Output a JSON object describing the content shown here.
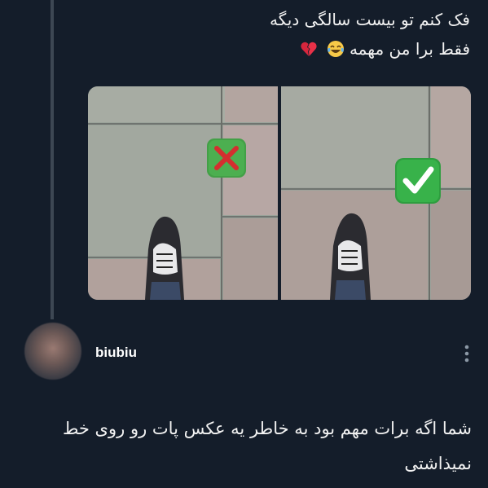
{
  "post": {
    "line1": "فک کنم تو بیست سالگی دیگه",
    "line2": "فقط برا من مهمه",
    "emojis": [
      "laughing-tears-emoji",
      "broken-heart-emoji"
    ]
  },
  "photos": [
    {
      "badge": "cross-mark-icon",
      "badge_color": "#d32f2f"
    },
    {
      "badge": "check-mark-icon",
      "badge_color": "#2ea043"
    }
  ],
  "reply": {
    "username": "biubiu",
    "text": "شما اگه برات مهم بود به خاطر یه عکس پات رو روی خط نمیذاشتی"
  },
  "colors": {
    "background": "#141d2a",
    "thread_line": "#3d4753",
    "text": "#f2f2f2"
  }
}
